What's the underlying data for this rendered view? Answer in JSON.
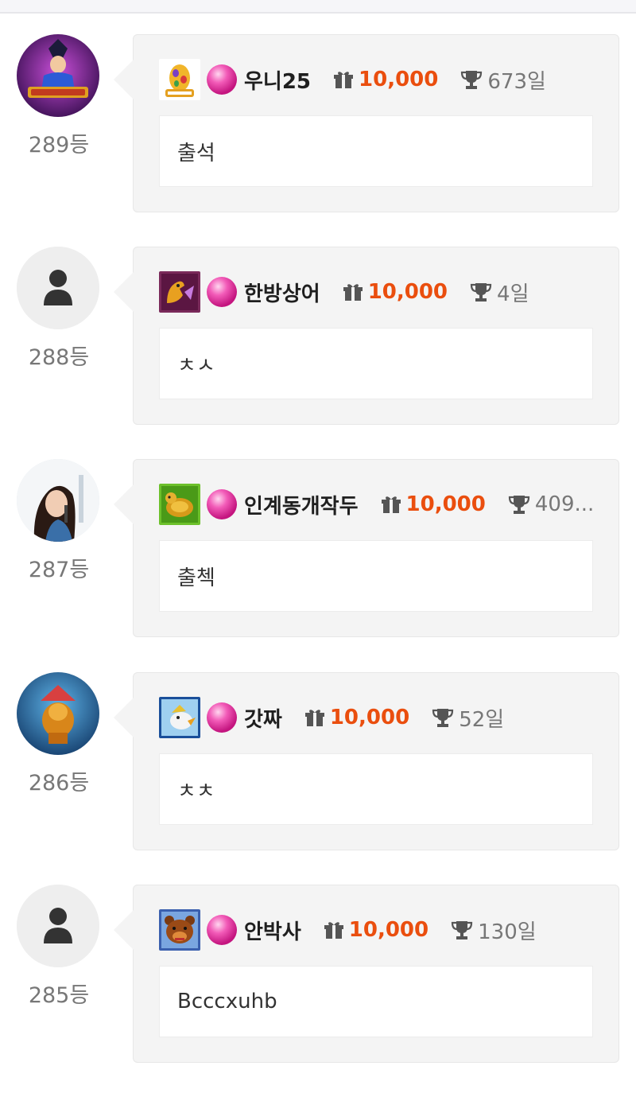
{
  "entries": [
    {
      "rank": "289등",
      "nickname": "우니25",
      "points": "10,000",
      "days": "673일",
      "message": "출석",
      "avatar": "game-art-avatar",
      "level_icon": "egg-icon"
    },
    {
      "rank": "288등",
      "nickname": "한방상어",
      "points": "10,000",
      "days": "4일",
      "message": "ㅊㅅ",
      "avatar": "default-user-avatar",
      "level_icon": "dragon-icon"
    },
    {
      "rank": "287등",
      "nickname": "인계동개작두",
      "points": "10,000",
      "days": "409...",
      "message": "출첵",
      "avatar": "photo-avatar",
      "level_icon": "turtle-icon"
    },
    {
      "rank": "286등",
      "nickname": "갓짜",
      "points": "10,000",
      "days": "52일",
      "message": "ㅊㅊ",
      "avatar": "lion-avatar",
      "level_icon": "bird-icon"
    },
    {
      "rank": "285등",
      "nickname": "안박사",
      "points": "10,000",
      "days": "130일",
      "message": "Bcccxuhb",
      "avatar": "default-user-avatar",
      "level_icon": "bear-icon"
    }
  ],
  "colors": {
    "points": "#ea4e0e",
    "bubble_bg": "#f4f4f4",
    "rank_text": "#777777"
  }
}
